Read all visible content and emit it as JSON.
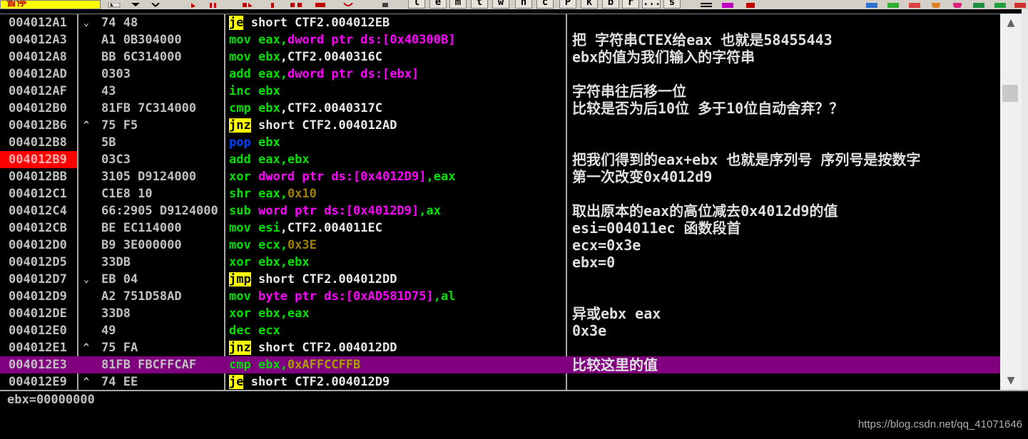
{
  "toolbar": {
    "status": "暂停",
    "letters": [
      "l",
      "e",
      "m",
      "t",
      "w",
      "h",
      "c",
      "P",
      "k",
      "b",
      "r",
      "...",
      "s"
    ],
    "icons": [
      "rewind-icon",
      "run-icon",
      "pause-icon",
      "step-into-icon",
      "step-over-icon",
      "trace-into-icon",
      "trace-over-icon",
      "execute-till-return-icon",
      "goto-icon"
    ]
  },
  "rows": [
    {
      "addr": "004012A1",
      "mark": "⌄",
      "hex": "74 48",
      "mn": "je",
      "mnStyle": "jc",
      "ops": [
        {
          "t": "short CTF2.004012EB",
          "c": "plain"
        }
      ],
      "comment": ""
    },
    {
      "addr": "004012A3",
      "mark": "",
      "hex": "A1 0B304000",
      "mn": "mov",
      "ops": [
        {
          "t": "eax",
          "c": "reg"
        },
        {
          "t": ",",
          "c": "reg"
        },
        {
          "t": "dword ptr ds:[0x40300B]",
          "c": "mem"
        }
      ],
      "comment": "把 字符串CTEX给eax 也就是58455443"
    },
    {
      "addr": "004012A8",
      "mark": "",
      "hex": "BB 6C314000",
      "mn": "mov",
      "ops": [
        {
          "t": "ebx",
          "c": "reg"
        },
        {
          "t": ",CTF2.0040316C",
          "c": "plain"
        }
      ],
      "comment": "ebx的值为我们输入的字符串"
    },
    {
      "addr": "004012AD",
      "mark": "",
      "hex": "0303",
      "mn": "add",
      "ops": [
        {
          "t": "eax",
          "c": "reg"
        },
        {
          "t": ",",
          "c": "reg"
        },
        {
          "t": "dword ptr ds:[ebx]",
          "c": "mem"
        }
      ],
      "comment": ""
    },
    {
      "addr": "004012AF",
      "mark": "",
      "hex": "43",
      "mn": "inc",
      "ops": [
        {
          "t": "ebx",
          "c": "reg"
        }
      ],
      "comment": "字符串往后移一位"
    },
    {
      "addr": "004012B0",
      "mark": "",
      "hex": "81FB 7C314000",
      "mn": "cmp",
      "ops": [
        {
          "t": "ebx",
          "c": "reg"
        },
        {
          "t": ",CTF2.0040317C",
          "c": "plain"
        }
      ],
      "comment": "比较是否为后10位 多于10位自动舍弃？？"
    },
    {
      "addr": "004012B6",
      "mark": "^",
      "hex": "75 F5",
      "mn": "jnz",
      "mnStyle": "jc",
      "ops": [
        {
          "t": "short CTF2.004012AD",
          "c": "plain"
        }
      ],
      "comment": ""
    },
    {
      "addr": "004012B8",
      "mark": "",
      "hex": "5B",
      "mn": "pop",
      "mnStyle": "pop",
      "ops": [
        {
          "t": "ebx",
          "c": "reg"
        }
      ],
      "comment": ""
    },
    {
      "addr": "004012B9",
      "mark": "",
      "hex": "03C3",
      "mn": "add",
      "ops": [
        {
          "t": "eax",
          "c": "reg"
        },
        {
          "t": ",ebx",
          "c": "reg"
        }
      ],
      "comment": "把我们得到的eax+ebx 也就是序列号 序列号是按数字",
      "bp": true
    },
    {
      "addr": "004012BB",
      "mark": "",
      "hex": "3105 D9124000",
      "mn": "xor",
      "ops": [
        {
          "t": "dword ptr ds:[0x4012D9]",
          "c": "mem"
        },
        {
          "t": ",eax",
          "c": "reg"
        }
      ],
      "comment": "第一次改变0x4012d9"
    },
    {
      "addr": "004012C1",
      "mark": "",
      "hex": "C1E8 10",
      "mn": "shr",
      "ops": [
        {
          "t": "eax",
          "c": "reg"
        },
        {
          "t": ",",
          "c": "reg"
        },
        {
          "t": "0x10",
          "c": "imm"
        }
      ],
      "comment": ""
    },
    {
      "addr": "004012C4",
      "mark": "",
      "hex": "66:2905 D9124000",
      "mn": "sub",
      "ops": [
        {
          "t": "word ptr ds:[0x4012D9]",
          "c": "mem"
        },
        {
          "t": ",ax",
          "c": "reg"
        }
      ],
      "comment": "取出原本的eax的高位减去0x4012d9的值"
    },
    {
      "addr": "004012CB",
      "mark": "",
      "hex": "BE EC114000",
      "mn": "mov",
      "ops": [
        {
          "t": "esi",
          "c": "reg"
        },
        {
          "t": ",CTF2.004011EC",
          "c": "plain"
        }
      ],
      "comment": "esi=004011ec 函数段首"
    },
    {
      "addr": "004012D0",
      "mark": "",
      "hex": "B9 3E000000",
      "mn": "mov",
      "ops": [
        {
          "t": "ecx",
          "c": "reg"
        },
        {
          "t": ",",
          "c": "reg"
        },
        {
          "t": "0x3E",
          "c": "imm"
        }
      ],
      "comment": "ecx=0x3e"
    },
    {
      "addr": "004012D5",
      "mark": "",
      "hex": "33DB",
      "mn": "xor",
      "ops": [
        {
          "t": "ebx",
          "c": "reg"
        },
        {
          "t": ",ebx",
          "c": "reg"
        }
      ],
      "comment": "ebx=0"
    },
    {
      "addr": "004012D7",
      "mark": "⌄",
      "hex": "EB 04",
      "mn": "jmp",
      "mnStyle": "jmp",
      "ops": [
        {
          "t": "short CTF2.004012DD",
          "c": "plain"
        }
      ],
      "comment": ""
    },
    {
      "addr": "004012D9",
      "mark": "",
      "hex": "A2 751D58AD",
      "mn": "mov",
      "ops": [
        {
          "t": "byte ptr ds:[0xAD581D75]",
          "c": "mem"
        },
        {
          "t": ",al",
          "c": "reg"
        }
      ],
      "comment": ""
    },
    {
      "addr": "004012DE",
      "mark": "",
      "hex": "33D8",
      "mn": "xor",
      "ops": [
        {
          "t": "ebx",
          "c": "reg"
        },
        {
          "t": ",eax",
          "c": "reg"
        }
      ],
      "comment": "异或ebx eax"
    },
    {
      "addr": "004012E0",
      "mark": "",
      "hex": "49",
      "mn": "dec",
      "ops": [
        {
          "t": "ecx",
          "c": "reg"
        }
      ],
      "comment": "0x3e"
    },
    {
      "addr": "004012E1",
      "mark": "^",
      "hex": "75 FA",
      "mn": "jnz",
      "mnStyle": "jc",
      "ops": [
        {
          "t": "short CTF2.004012DD",
          "c": "plain"
        }
      ],
      "comment": ""
    },
    {
      "addr": "004012E3",
      "mark": "",
      "hex": "81FB FBCFFCAF",
      "mn": "cmp",
      "ops": [
        {
          "t": "ebx",
          "c": "reg"
        },
        {
          "t": ",",
          "c": "reg"
        },
        {
          "t": "0xAFFCCFFB",
          "c": "sel"
        }
      ],
      "comment": "比较这里的值",
      "selected": true
    },
    {
      "addr": "004012E9",
      "mark": "^",
      "hex": "74 EE",
      "mn": "je",
      "mnStyle": "jc",
      "ops": [
        {
          "t": "short CTF2.004012D9",
          "c": "plain"
        }
      ],
      "comment": ""
    }
  ],
  "info": {
    "text": "ebx=00000000"
  },
  "watermark": "https://blog.csdn.net/qq_41071646"
}
